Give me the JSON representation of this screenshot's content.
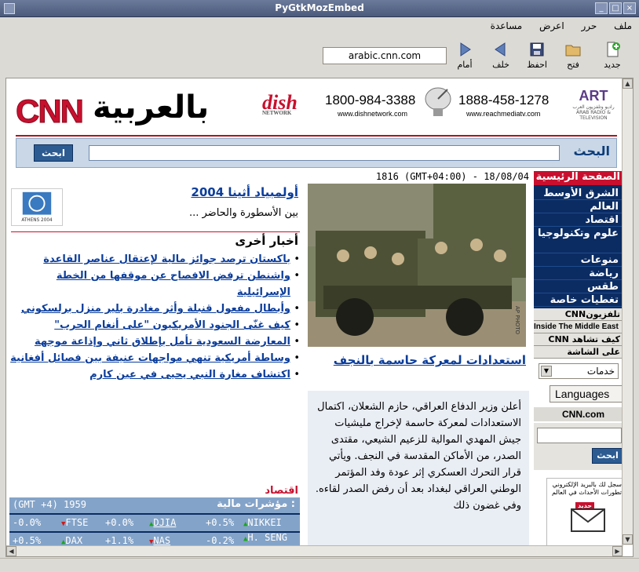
{
  "window": {
    "title": "PyGtkMozEmbed"
  },
  "menubar": {
    "items": [
      "ملف",
      "حرر",
      "اعرض",
      "مساعدة"
    ]
  },
  "toolbar": {
    "new_label": "جديد",
    "open_label": "فتح",
    "save_label": "احفظ",
    "back_label": "خلف",
    "forward_label": "أمام",
    "url": "arabic.cnn.com"
  },
  "header": {
    "logo_latin": "CNN",
    "logo_arabic": "بالعربية",
    "dish_logo": "dish",
    "dish_logo_sub": "NETWORK",
    "dish_phone": "1800-984-3388",
    "dish_site": "www.dishnetwork.com",
    "reach_phone": "1888-458-1278",
    "reach_site": "www.reachmediatv.com",
    "art_logo": "ART",
    "art_sub": "راديو وتلفزيون العرب ARAB RADIO & TELEVISION"
  },
  "search": {
    "label": "البحث",
    "button": "ابحث"
  },
  "date_line": "1816 (GMT+04:00) - 18/08/04",
  "right_nav": {
    "home": "الصفحة الرئيسية",
    "items": [
      "الشرق الأوسط",
      "العالم",
      "اقتصاد",
      "علوم وتكنولوجيا",
      "منوعات",
      "رياضة",
      "طقس",
      "تغطيات خاصة"
    ],
    "cnn_arabic": "تلفزيونCNN",
    "inside": "Inside The Middle East",
    "watch_cnn": "كيف تشاهد CNN",
    "screen": "على الشاشة",
    "dropdown_value": "خدمات",
    "languages": "Languages",
    "cnn_com": "CNN.com",
    "search_button": "ابحث",
    "ad_text": "سجل لك بالبريد الإلكتروني تطورات الأحداث في العالم",
    "ad_badge": "جديد"
  },
  "main": {
    "photo_credit": "AP PHOTO",
    "headline": "استعدادات لمعركة حاسمة بالنجف",
    "body": "أعلن وزير الدفاع العراقي، حازم الشعلان، اكتمال الاستعدادات لمعركة حاسمة لإخراج مليشيات جيش المهدي الموالية للزعيم الشيعي، مقتدى الصدر، من الأماكن المقدسة في النجف. ويأتي قرار التحرك العسكري إثر عودة وفد المؤتمر الوطني العراقي لبغداد بعد أن رفض الصدر لقاءه. وفي غضون ذلك"
  },
  "left": {
    "olympic_img_caption": "ATHENS 2004",
    "olympic_title": "أولمبياد أثينا 2004",
    "olympic_sub": "بين الأسطورة والحاضر ...",
    "other_news_title": "أخبار أخرى",
    "news": [
      "باكستان ترصد جوائز مالية لإعتقال عناصر القاعدة",
      "واشنطن ترفض الافصاح عن موقفها من الخطة الإسرائيلية",
      "وأبطال مفعول قنبلة وأثر مغادرة بلير منزل برلسكوني",
      "كيف غنّى الجنود الأمريكيون \"على أنغام الحرب\"",
      "المعارضة السعودية تأمل بإطلاق ثاني وإذاعة موجهة",
      "وساطة أمريكية تنهي مواجهات عنيفة بين فصائل أفغانية",
      "اكتشاف مغارة النبي يحيى في عين كارم"
    ],
    "econ_title": "اقتصاد",
    "econ_label": "مؤشرات مالية :",
    "econ_time": "(GMT +4) 1959",
    "indices": [
      {
        "name": "NIKKEI",
        "value": "+0.5%",
        "dir": "up"
      },
      {
        "name": "DJIA",
        "value": "+0.0%",
        "dir": "up"
      },
      {
        "name": "FTSE",
        "value": "-0.0%",
        "dir": "down"
      },
      {
        "name": "H. SENG",
        "value": "-0.2%",
        "dir": "up"
      },
      {
        "name": "NAS",
        "value": "+1.1%",
        "dir": "down"
      },
      {
        "name": "DAX",
        "value": "+0.5%",
        "dir": "up"
      }
    ]
  },
  "colors": {
    "cnn_red": "#c8102e",
    "link_blue": "#0b3d9b",
    "nav_navy": "#0b2c63",
    "econ_blue": "#84a3c8"
  }
}
